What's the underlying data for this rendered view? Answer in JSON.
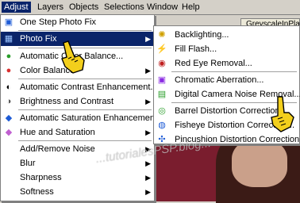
{
  "menubar": {
    "items": [
      "Adjust",
      "Layers",
      "Objects",
      "Selections",
      "Window",
      "Help"
    ]
  },
  "document": {
    "tab_label": "GreyscaleInPlace"
  },
  "watermark": "...tutorialesPSP.blog...",
  "adjust_menu": {
    "items": [
      {
        "label": "One Step Photo Fix",
        "icon": "one-step-photo-fix-icon"
      },
      {
        "label": "Photo Fix",
        "icon": "photo-fix-icon",
        "submenu": true,
        "highlighted": true
      },
      {
        "label": "Automatic Color Balance...",
        "icon": "color-balance-icon"
      },
      {
        "label": "Color Balance",
        "icon": "color-balance-icon",
        "submenu": true
      },
      {
        "label": "Automatic Contrast Enhancement...",
        "icon": "contrast-icon"
      },
      {
        "label": "Brightness and Contrast",
        "icon": "brightness-icon",
        "submenu": true
      },
      {
        "label": "Automatic Saturation Enhancement...",
        "icon": "saturation-icon"
      },
      {
        "label": "Hue and Saturation",
        "icon": "hue-icon",
        "submenu": true
      },
      {
        "label": "Add/Remove Noise",
        "submenu": true
      },
      {
        "label": "Blur",
        "submenu": true
      },
      {
        "label": "Sharpness",
        "submenu": true
      },
      {
        "label": "Softness",
        "submenu": true
      }
    ]
  },
  "photo_fix_menu": {
    "items": [
      {
        "label": "Backlighting...",
        "icon": "backlighting-icon"
      },
      {
        "label": "Fill Flash...",
        "icon": "fill-flash-icon"
      },
      {
        "label": "Red Eye Removal...",
        "icon": "red-eye-icon"
      },
      {
        "label": "Chromatic Aberration...",
        "icon": "chromatic-aberration-icon"
      },
      {
        "label": "Digital Camera Noise Removal...",
        "icon": "noise-removal-icon"
      },
      {
        "label": "Barrel Distortion Correction...",
        "icon": "barrel-distortion-icon"
      },
      {
        "label": "Fisheye Distortion Correction...",
        "icon": "fisheye-icon"
      },
      {
        "label": "Pincushion Distortion Correction...",
        "icon": "pincushion-icon"
      }
    ]
  }
}
